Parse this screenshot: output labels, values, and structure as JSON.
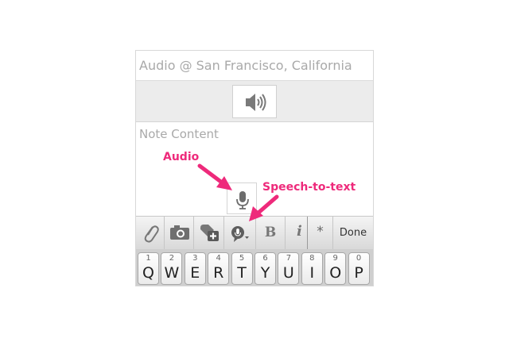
{
  "title_field": {
    "value": "Audio @ San Francisco, California"
  },
  "note": {
    "placeholder": "Note Content"
  },
  "callouts": {
    "audio": "Audio",
    "speech": "Speech-to-text"
  },
  "toolbar": {
    "icons": [
      "paperclip-icon",
      "camera-icon",
      "add-tag-icon",
      "speech-mic-icon"
    ],
    "bold_label": "B",
    "italic_label": "i",
    "star_label": "*",
    "done_label": "Done"
  },
  "keyboard": {
    "keys": [
      {
        "num": "1",
        "letter": "Q"
      },
      {
        "num": "2",
        "letter": "W"
      },
      {
        "num": "3",
        "letter": "E"
      },
      {
        "num": "4",
        "letter": "R"
      },
      {
        "num": "5",
        "letter": "T"
      },
      {
        "num": "6",
        "letter": "Y"
      },
      {
        "num": "7",
        "letter": "U"
      },
      {
        "num": "8",
        "letter": "I"
      },
      {
        "num": "9",
        "letter": "O"
      },
      {
        "num": "0",
        "letter": "P"
      }
    ]
  },
  "colors": {
    "callout": "#ee2a7b",
    "placeholder": "#a9a9a9"
  }
}
